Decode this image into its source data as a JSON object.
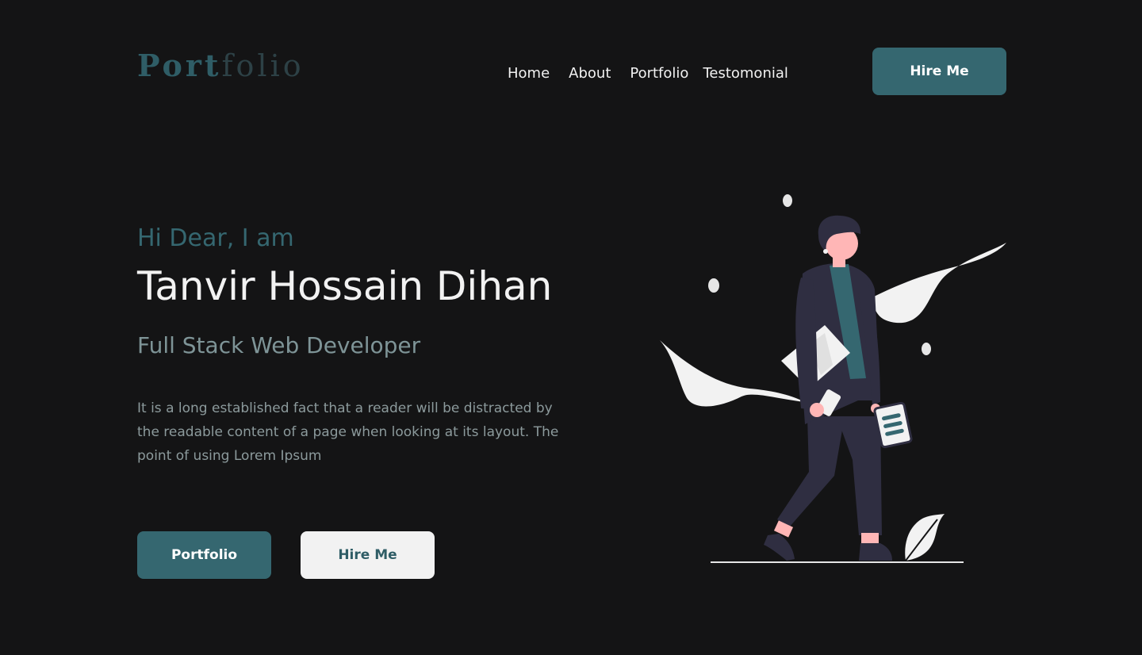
{
  "header": {
    "logo_part1": "Port",
    "logo_part2": "folio",
    "nav": [
      {
        "label": "Home"
      },
      {
        "label": "About"
      },
      {
        "label": "Portfolio"
      },
      {
        "label": "Testomonial"
      }
    ],
    "cta_label": "Hire Me"
  },
  "hero": {
    "greeting": "Hi Dear, I am",
    "name": "Tanvir Hossain Dihan",
    "role": "Full Stack Web Developer",
    "description": "It is a long established fact that a reader will be distracted by the readable content of a page when looking at its layout. The point of using Lorem Ipsum",
    "primary_button": "Portfolio",
    "secondary_button": "Hire Me"
  },
  "colors": {
    "background": "#141415",
    "accent": "#356770",
    "text_light": "#f2f2f2",
    "text_muted": "#8c9a9c"
  }
}
